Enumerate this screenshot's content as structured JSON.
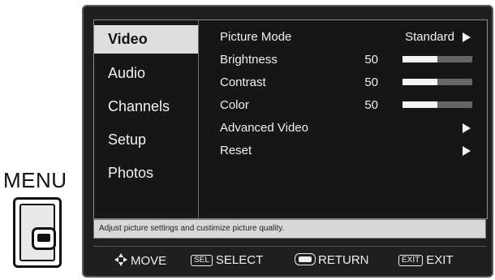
{
  "remote": {
    "menu_label": "MENU",
    "menu_key_icon": "menu-key-icon"
  },
  "tabs": [
    {
      "label": "Video",
      "active": true
    },
    {
      "label": "Audio",
      "active": false
    },
    {
      "label": "Channels",
      "active": false
    },
    {
      "label": "Setup",
      "active": false
    },
    {
      "label": "Photos",
      "active": false
    }
  ],
  "settings": {
    "picture_mode": {
      "label": "Picture Mode",
      "value": "Standard"
    },
    "brightness": {
      "label": "Brightness",
      "value": "50",
      "level": 0.5
    },
    "contrast": {
      "label": "Contrast",
      "value": "50",
      "level": 0.5
    },
    "color": {
      "label": "Color",
      "value": "50",
      "level": 0.5
    },
    "advanced_video": {
      "label": "Advanced Video"
    },
    "reset": {
      "label": "Reset"
    }
  },
  "help_text": "Adjust picture settings and custimize picture quality.",
  "footer": {
    "move": "MOVE",
    "select_key": "SEL",
    "select": "SELECT",
    "return": "RETURN",
    "exit_key": "EXIT",
    "exit": "EXIT"
  },
  "colors": {
    "active_tab_bg": "#dedede",
    "panel_bg": "#161616",
    "screen_bg": "#1f1f1f",
    "help_bg": "#d8d8d8"
  }
}
